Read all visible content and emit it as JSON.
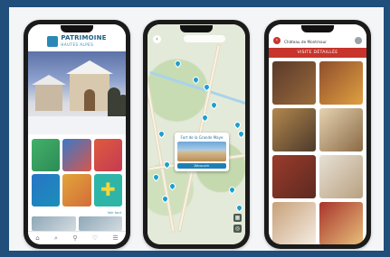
{
  "phone1": {
    "logo_title": "PATRIMOINE",
    "logo_subtitle": "HAUTES ALPES",
    "tiles": [
      "",
      "",
      "",
      "",
      "",
      ""
    ],
    "section_label": "",
    "see_all": "Voir tout"
  },
  "phone2": {
    "search_text": "",
    "popup_title": "Fort de la Grande Maye",
    "popup_button": "Découvrir"
  },
  "phone3": {
    "title": "Château de Montmaur",
    "banner": "VISITE DÉTAILLÉE",
    "cards": [
      "",
      "",
      "",
      "",
      "",
      "",
      "",
      ""
    ]
  }
}
